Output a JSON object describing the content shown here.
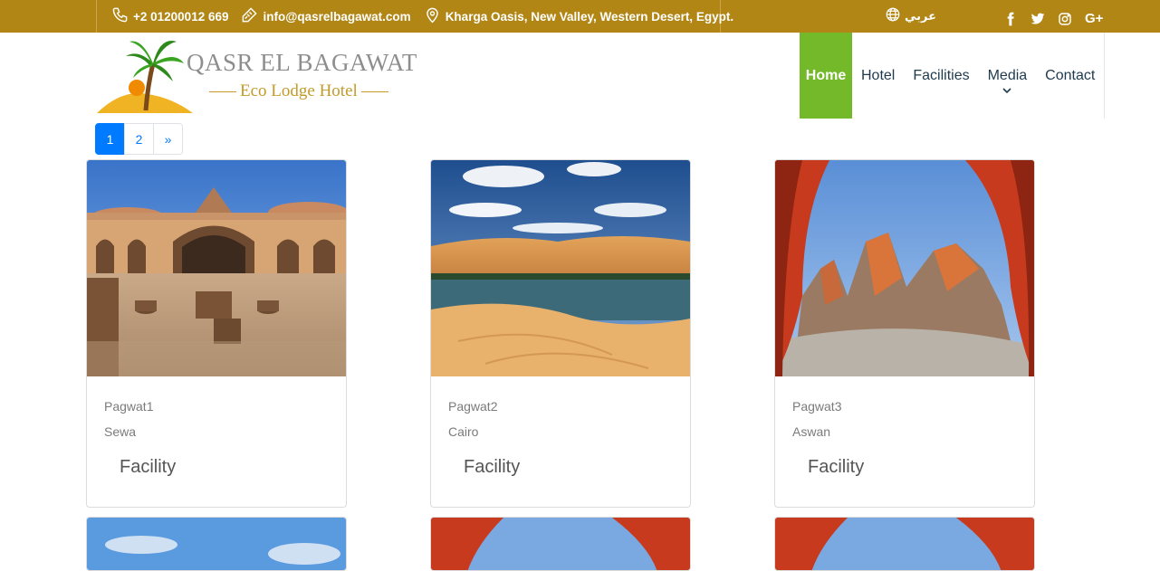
{
  "topbar": {
    "phone": "+2 01200012 669",
    "email": "info@qasrelbagawat.com",
    "address": "Kharga Oasis, New Valley, Western Desert, Egypt.",
    "language": "عربي",
    "social": [
      "facebook-icon",
      "twitter-icon",
      "instagram-icon",
      "google-plus-icon"
    ],
    "google_plus_label": "G+"
  },
  "brand": {
    "title": "QASR EL BAGAWAT",
    "subtitle": "Eco Lodge Hotel"
  },
  "nav": {
    "items": [
      {
        "label": "Home",
        "active": true
      },
      {
        "label": "Hotel"
      },
      {
        "label": "Facilities"
      },
      {
        "label": "Media"
      },
      {
        "label": "Contact"
      }
    ],
    "accent": "#73b929"
  },
  "pagination": {
    "pages": [
      "1",
      "2",
      "»"
    ],
    "active": "1"
  },
  "cards": [
    {
      "name": "Pagwat1",
      "location": "Sewa",
      "category": "Facility"
    },
    {
      "name": "Pagwat2",
      "location": "Cairo",
      "category": "Facility"
    },
    {
      "name": "Pagwat3",
      "location": "Aswan",
      "category": "Facility"
    }
  ],
  "colors": {
    "topbar": "#b18615",
    "brand_gold": "#c49a2a",
    "link_blue": "#007bff"
  }
}
